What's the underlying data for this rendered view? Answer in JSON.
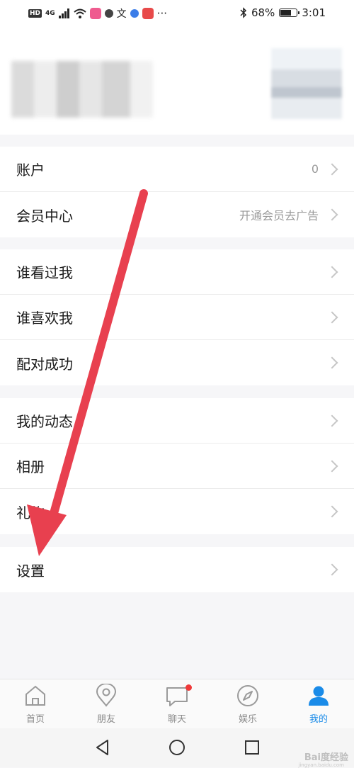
{
  "status_bar": {
    "left_badge": "HD",
    "network": "4G",
    "battery_percent": "68%",
    "time": "3:01",
    "more": "···"
  },
  "sections": [
    {
      "items": [
        {
          "label": "账户",
          "value": "0"
        },
        {
          "label": "会员中心",
          "value": "开通会员去广告"
        }
      ]
    },
    {
      "items": [
        {
          "label": "谁看过我"
        },
        {
          "label": "谁喜欢我"
        },
        {
          "label": "配对成功"
        }
      ]
    },
    {
      "items": [
        {
          "label": "我的动态"
        },
        {
          "label": "相册"
        },
        {
          "label": "礼物"
        }
      ]
    },
    {
      "items": [
        {
          "label": "设置"
        }
      ]
    }
  ],
  "tabbar": {
    "tabs": [
      {
        "label": "首页",
        "icon": "home-icon"
      },
      {
        "label": "朋友",
        "icon": "location-pin-icon"
      },
      {
        "label": "聊天",
        "icon": "chat-bubble-icon",
        "badge": true
      },
      {
        "label": "娱乐",
        "icon": "compass-icon"
      },
      {
        "label": "我的",
        "icon": "person-icon",
        "active": true
      }
    ]
  },
  "colors": {
    "accent": "#1a8be8",
    "badge": "#f03a3a",
    "arrow": "#e8404f"
  },
  "watermark": {
    "text": "Bai度经验",
    "sub": "jingyan.baidu.com"
  }
}
